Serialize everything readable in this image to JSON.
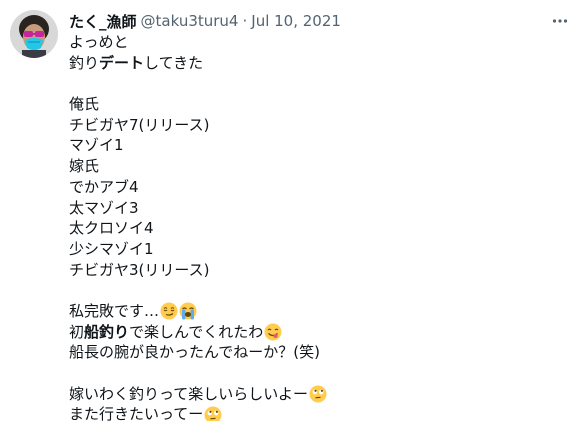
{
  "tweet": {
    "display_name": "たく_漁師",
    "handle": "@taku3turu4",
    "separator": "·",
    "date": "Jul 10, 2021",
    "lines": {
      "l1": "よっめと",
      "l2a": "釣り",
      "l2b": "デート",
      "l2c": "してきた",
      "l4": "俺氏",
      "l5": "チビガヤ7(リリース)",
      "l6": "マゾイ1",
      "l7": "嫁氏",
      "l8": "でかアブ4",
      "l9": "太マゾイ3",
      "l10": "太クロソイ4",
      "l11": "少シマゾイ1",
      "l12": "チビガヤ3(リリース)",
      "l14": "私完敗です…",
      "l15a": "初",
      "l15b": "船釣り",
      "l15c": "で楽しんでくれたわ",
      "l16": "船長の腕が良かったんでねーか？(笑)",
      "l18": "嫁いわく釣りって楽しいらしいよー",
      "l19": "また行きたいってー"
    },
    "emojis": [
      "smirking-face-emoji",
      "loudly-crying-face-emoji",
      "face-savoring-food-emoji",
      "face-with-rolling-eyes-emoji",
      "face-with-rolling-eyes-emoji"
    ]
  },
  "colors": {
    "text": "#0f1419",
    "secondary": "#536471",
    "emoji_yellow": "#ffcc4d",
    "emoji_tear": "#5dadec",
    "tongue": "#e75a70"
  }
}
